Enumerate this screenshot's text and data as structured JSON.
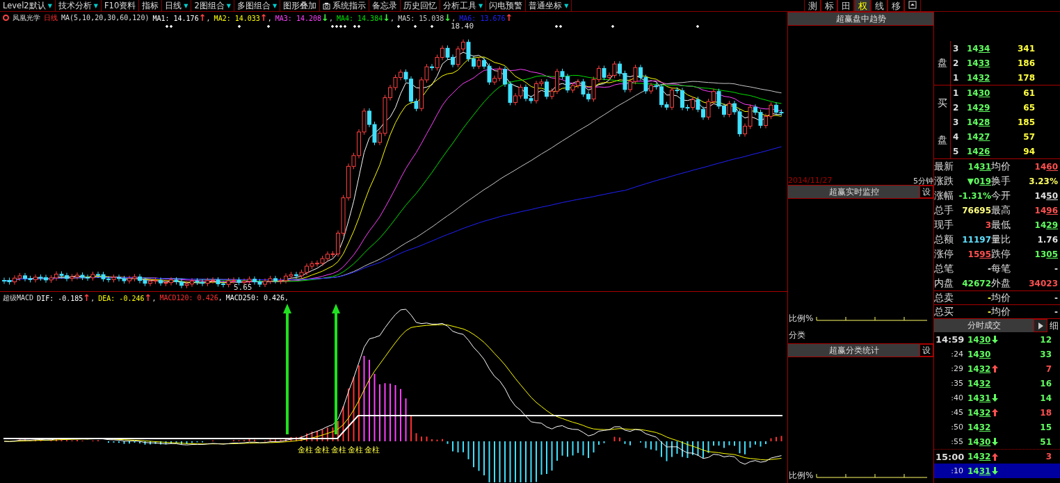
{
  "toolbar": {
    "items": [
      {
        "label": "Level2默认",
        "caret": "▼"
      },
      {
        "label": "技术分析",
        "caret": "▼"
      },
      {
        "label": "F10资料"
      },
      {
        "label": "指标"
      },
      {
        "label": "日线",
        "caret": "▼"
      },
      {
        "label": "2图组合",
        "caret": "▼"
      },
      {
        "label": "多图组合",
        "caret": "▼"
      },
      {
        "label": "图形叠加"
      },
      {
        "label": "系统指示",
        "icon": true
      },
      {
        "label": "备忘录"
      },
      {
        "label": "历史回忆"
      },
      {
        "label": "分析工具",
        "caret": "▼"
      },
      {
        "label": "闪电预警"
      },
      {
        "label": "普通坐标",
        "caret": "▼"
      }
    ],
    "tools": [
      {
        "label": "测",
        "selected": false
      },
      {
        "label": "标",
        "selected": false
      },
      {
        "label": "田",
        "selected": false
      },
      {
        "label": "权",
        "selected": true
      },
      {
        "label": "线",
        "selected": false
      },
      {
        "label": "移",
        "selected": false
      }
    ]
  },
  "price_chart": {
    "stock": "凤凰光学",
    "period": "日线",
    "ma_label": "MA(5,10,20,30,60,120)",
    "ma_values": [
      {
        "text": "MA1: 14.176",
        "arrow": {
          "text": "↑",
          "color": "#ff4040"
        },
        "sep": ",",
        "color": "#ffffff"
      },
      {
        "text": "MA2: 14.033",
        "arrow": {
          "text": "↑",
          "color": "#ff4040"
        },
        "sep": ",",
        "color": "#ffff00"
      },
      {
        "text": "MA3: 14.208",
        "arrow": {
          "text": "↓",
          "color": "#40ff40"
        },
        "sep": ",",
        "color": "#ff40ff"
      },
      {
        "text": "MA4: 14.384",
        "arrow": {
          "text": "↓",
          "color": "#40ff40"
        },
        "sep": ",",
        "color": "#00e000"
      },
      {
        "text": "MA5: 15.038",
        "arrow": {
          "text": "↓",
          "color": "#40ff40"
        },
        "sep": ",",
        "color": "#c8c8c8"
      },
      {
        "text": "MA6: 13.676",
        "arrow": {
          "text": "↑",
          "color": "#ff4040"
        },
        "color": "#2020ff"
      }
    ],
    "high_label": "18.40",
    "low_label": "5.65"
  },
  "macd_chart": {
    "title": "超级MACD",
    "values": [
      {
        "text": "DIF: -0.185",
        "arrow": {
          "text": "↑",
          "color": "#ff4040"
        },
        "sep": ",",
        "color": "#ffffff"
      },
      {
        "text": "DEA: -0.246",
        "arrow": {
          "text": "↑",
          "color": "#ff4040"
        },
        "sep": ",",
        "color": "#ffff00"
      },
      {
        "text": "MACD120: 0.426",
        "sep": ",",
        "color": "#ff3030"
      },
      {
        "text": "MACD250: 0.426",
        "sep": ",",
        "color": "#ffffff"
      }
    ],
    "signals": [
      "金柱",
      "金柱",
      "金柱",
      "金柱",
      "金柱"
    ]
  },
  "middle_panel": {
    "trend_title": "超赢盘中趋势",
    "date": "2014/11/27",
    "interval": "5分钟",
    "monitor_title": "超赢实时监控",
    "monitor_button": "设",
    "ratio_label": "比例%",
    "category_label": "分类",
    "stats_title": "超赢分类统计",
    "stats_button": "设",
    "stats_ratio_label": "比例%"
  },
  "order_book": {
    "sell_label": "盘",
    "sell": [
      {
        "level": "3",
        "price": "14",
        "price_underlined": "34",
        "volume": "341"
      },
      {
        "level": "2",
        "price": "14",
        "price_underlined": "33",
        "volume": "186"
      },
      {
        "level": "1",
        "price": "14",
        "price_underlined": "32",
        "volume": "178"
      }
    ],
    "buy_labels": [
      "买",
      "盘"
    ],
    "buy": [
      {
        "level": "1",
        "price": "14",
        "price_underlined": "30",
        "volume": "61"
      },
      {
        "level": "2",
        "price": "14",
        "price_underlined": "29",
        "volume": "65"
      },
      {
        "level": "3",
        "price": "14",
        "price_underlined": "28",
        "volume": "185"
      },
      {
        "level": "4",
        "price": "14",
        "price_underlined": "27",
        "volume": "57"
      },
      {
        "level": "5",
        "price": "14",
        "price_underlined": "26",
        "volume": "94"
      }
    ]
  },
  "quote": [
    {
      "left": {
        "label": "最新",
        "value": "14",
        "value_underlined": "31",
        "color": "#60ff60"
      },
      "right": {
        "label": "均价",
        "value": "14",
        "value_underlined": "60",
        "color": "#ff5050"
      }
    },
    {
      "left": {
        "label": "涨跌",
        "value": "▼0",
        "value_underlined": "19",
        "color": "#60ff60"
      },
      "right": {
        "label": "换手",
        "value": "3.23%",
        "color": "#ffff60"
      }
    },
    {
      "left": {
        "label": "涨幅",
        "value": "-1.31%",
        "color": "#60ff60"
      },
      "right": {
        "label": "今开",
        "value": "14",
        "value_underlined": "50",
        "color": "#e0e0e0"
      }
    },
    {
      "left": {
        "label": "总手",
        "value": "76695",
        "color": "#ffff80"
      },
      "right": {
        "label": "最高",
        "value": "14",
        "value_underlined": "96",
        "color": "#ff5050"
      }
    },
    {
      "left": {
        "label": "现手",
        "value": "3",
        "color": "#ff5050"
      },
      "right": {
        "label": "最低",
        "value": "14",
        "value_underlined": "29",
        "color": "#60ff60"
      }
    },
    {
      "left": {
        "label": "总额",
        "value": "11197",
        "color": "#60e0ff"
      },
      "right": {
        "label": "量比",
        "value": "1.76",
        "color": "#e0e0e0"
      }
    },
    {
      "left": {
        "label": "涨停",
        "value": "15",
        "value_underlined": "95",
        "color": "#ff5050"
      },
      "right": {
        "label": "跌停",
        "value": "13",
        "value_underlined": "05",
        "color": "#60ff60"
      }
    },
    {
      "left": {
        "label": "总笔",
        "value": "-",
        "color": "#e0e0e0"
      },
      "right": {
        "label": "每笔",
        "value": "-",
        "color": "#e0e0e0"
      }
    },
    {
      "left": {
        "label": "内盘",
        "value": "42672",
        "color": "#60ff60"
      },
      "right": {
        "label": "外盘",
        "value": "34023",
        "color": "#ff5050"
      }
    }
  ],
  "totals": [
    {
      "label": "总卖",
      "value": "-",
      "label2": "均价",
      "value2": "-"
    },
    {
      "label": "总买",
      "value": "-",
      "label2": "均价",
      "value2": "-"
    }
  ],
  "trades": {
    "title": "分时成交",
    "detail_button": "细",
    "rows": [
      {
        "time": "14:59",
        "kind": "hour",
        "price": "14",
        "price_underlined": "30",
        "arrow_up": false,
        "arrow_down": true,
        "volume": "12",
        "color": "#60ff60",
        "selected": false
      },
      {
        "time": ":24",
        "kind": "minute",
        "price": "14",
        "price_underlined": "30",
        "arrow_up": false,
        "arrow_down": false,
        "volume": "33",
        "color": "#60ff60",
        "selected": false
      },
      {
        "time": ":29",
        "kind": "minute",
        "price": "14",
        "price_underlined": "32",
        "arrow_up": true,
        "arrow_down": false,
        "volume": "7",
        "color": "#ff5050",
        "selected": false
      },
      {
        "time": ":35",
        "kind": "minute",
        "price": "14",
        "price_underlined": "32",
        "arrow_up": false,
        "arrow_down": false,
        "volume": "16",
        "color": "#60ff60",
        "selected": false
      },
      {
        "time": ":40",
        "kind": "minute",
        "price": "14",
        "price_underlined": "31",
        "arrow_up": false,
        "arrow_down": true,
        "volume": "14",
        "color": "#60ff60",
        "selected": false
      },
      {
        "time": ":45",
        "kind": "minute",
        "price": "14",
        "price_underlined": "32",
        "arrow_up": true,
        "arrow_down": false,
        "volume": "18",
        "color": "#ff5050",
        "selected": false
      },
      {
        "time": ":50",
        "kind": "minute",
        "price": "14",
        "price_underlined": "32",
        "arrow_up": false,
        "arrow_down": false,
        "volume": "15",
        "color": "#60ff60",
        "selected": false
      },
      {
        "time": ":55",
        "kind": "minute",
        "price": "14",
        "price_underlined": "30",
        "arrow_up": false,
        "arrow_down": true,
        "volume": "51",
        "color": "#60ff60",
        "selected": false
      },
      {
        "time": "15:00",
        "kind": "hour",
        "price": "14",
        "price_underlined": "32",
        "arrow_up": true,
        "arrow_down": false,
        "volume": "3",
        "color": "#ff5050",
        "selected": false
      },
      {
        "time": ":10",
        "kind": "minute",
        "price": "14",
        "price_underlined": "31",
        "arrow_up": false,
        "arrow_down": true,
        "selected": true
      }
    ]
  }
}
